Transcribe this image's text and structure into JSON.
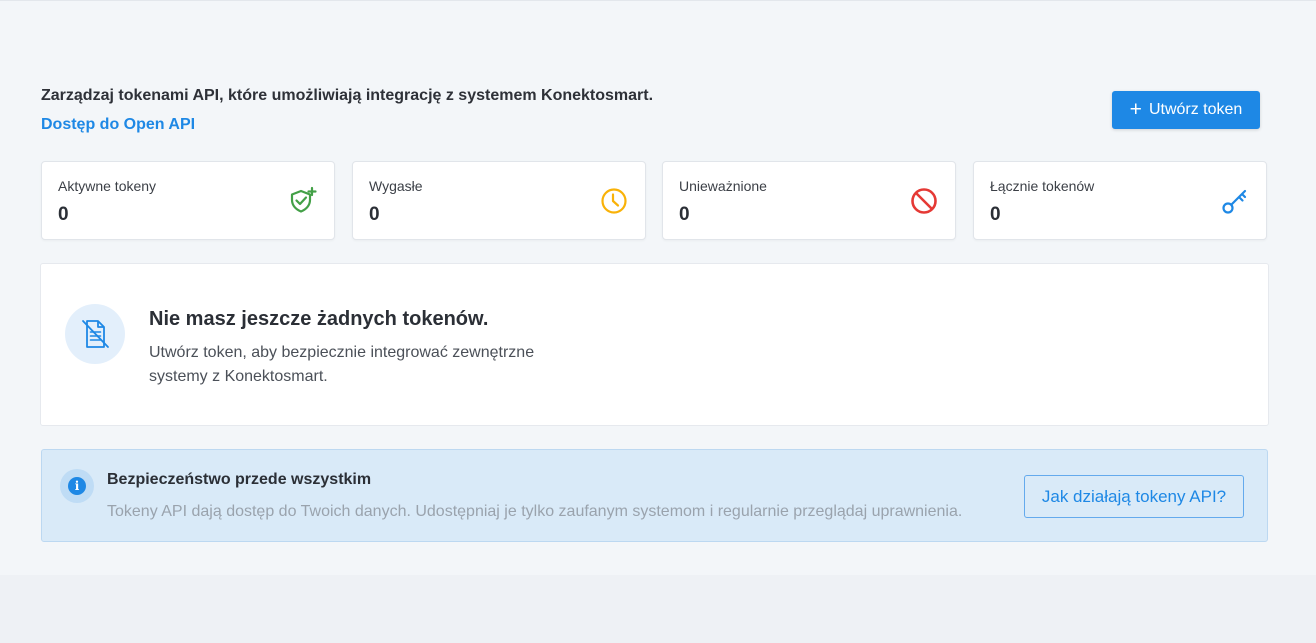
{
  "header": {
    "intro_text": "Zarządzaj tokenami API, które umożliwiają integrację z systemem Konektosmart.",
    "open_api_link": "Dostęp do Open API",
    "create_button": "Utwórz token"
  },
  "stats": [
    {
      "label": "Aktywne tokeny",
      "value": "0",
      "icon": "shield-check-icon",
      "color": "#43a047"
    },
    {
      "label": "Wygasłe",
      "value": "0",
      "icon": "clock-icon",
      "color": "#f9b208"
    },
    {
      "label": "Unieważnione",
      "value": "0",
      "icon": "ban-icon",
      "color": "#e53935"
    },
    {
      "label": "Łącznie tokenów",
      "value": "0",
      "icon": "key-icon",
      "color": "#1e88e5"
    }
  ],
  "empty_state": {
    "title": "Nie masz jeszcze żadnych tokenów.",
    "text": "Utwórz token, aby bezpiecznie integrować zewnętrzne systemy z Konektosmart.",
    "icon": "document-off-icon"
  },
  "security": {
    "title": "Bezpieczeństwo przede wszystkim",
    "text": "Tokeny API dają dostęp do Twoich danych. Udostępniaj je tylko zaufanym systemom i regularnie przeglądaj uprawnienia.",
    "button": "Jak działają tokeny API?",
    "icon": "info-icon"
  },
  "colors": {
    "accent": "#1e88e5",
    "background": "#f3f6f9",
    "info_background": "#d9eaf8"
  }
}
